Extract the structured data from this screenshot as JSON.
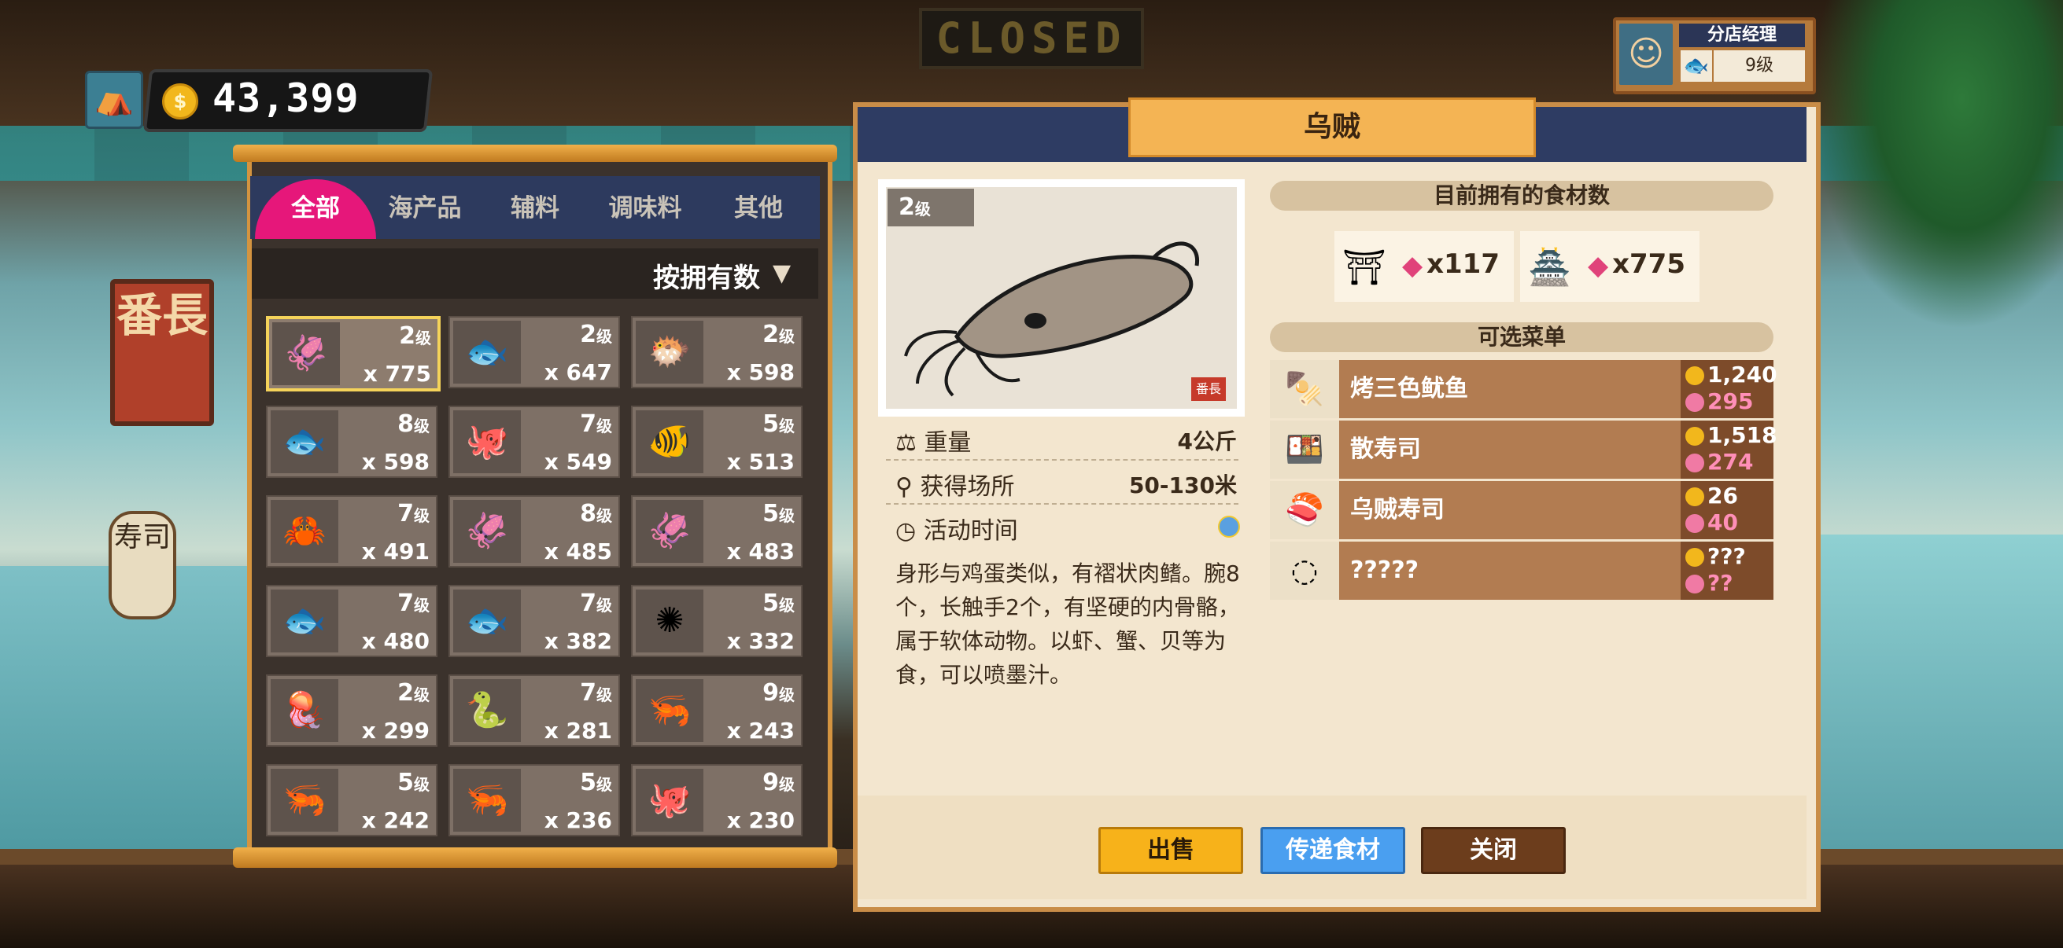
{
  "hud": {
    "home_icon": "hut-icon",
    "coins": "43,399",
    "coin_symbol": "$"
  },
  "scene": {
    "closed_sign": "CLOSED",
    "shop_sign": "番長",
    "lantern_text": "寿司"
  },
  "manager": {
    "title": "分店经理",
    "level": "9级"
  },
  "inventory": {
    "tabs": [
      "全部",
      "海产品",
      "辅料",
      "调味料",
      "其他"
    ],
    "sort_label": "按拥有数",
    "sort_arrow": "▼",
    "level_suffix": "级",
    "items": [
      {
        "name": "cuttlefish",
        "level": "2",
        "qty": "x 775",
        "icon": "🦑",
        "selected": true
      },
      {
        "name": "red-fish",
        "level": "2",
        "qty": "x 647",
        "icon": "🐟"
      },
      {
        "name": "yellow-fish",
        "level": "2",
        "qty": "x 598",
        "icon": "🐡"
      },
      {
        "name": "blue-fish",
        "level": "8",
        "qty": "x 598",
        "icon": "🐟"
      },
      {
        "name": "octopus",
        "level": "7",
        "qty": "x 549",
        "icon": "🐙"
      },
      {
        "name": "small-red-fish",
        "level": "5",
        "qty": "x 513",
        "icon": "🐠"
      },
      {
        "name": "blue-crab",
        "level": "7",
        "qty": "x 491",
        "icon": "🦀"
      },
      {
        "name": "purple-squid",
        "level": "8",
        "qty": "x 485",
        "icon": "🦑"
      },
      {
        "name": "grey-squid",
        "level": "5",
        "qty": "x 483",
        "icon": "🦑"
      },
      {
        "name": "silver-fish",
        "level": "7",
        "qty": "x 480",
        "icon": "🐟"
      },
      {
        "name": "tuna",
        "level": "7",
        "qty": "x 382",
        "icon": "🐟"
      },
      {
        "name": "sea-urchin",
        "level": "5",
        "qty": "x 332",
        "icon": "✺"
      },
      {
        "name": "jellyfish",
        "level": "2",
        "qty": "x 299",
        "icon": "🪼"
      },
      {
        "name": "eel",
        "level": "7",
        "qty": "x 281",
        "icon": "🐍"
      },
      {
        "name": "mantis-shrimp",
        "level": "9",
        "qty": "x 243",
        "icon": "🦐"
      },
      {
        "name": "prawn",
        "level": "5",
        "qty": "x 242",
        "icon": "🦐"
      },
      {
        "name": "shrimp",
        "level": "5",
        "qty": "x 236",
        "icon": "🦐"
      },
      {
        "name": "pale-octopus",
        "level": "9",
        "qty": "x 230",
        "icon": "🐙"
      }
    ]
  },
  "detail": {
    "title": "乌贼",
    "level_badge": "2",
    "level_suffix": "级",
    "stamp": "番長",
    "weight_label": "重量",
    "weight_value": "4公斤",
    "location_label": "获得场所",
    "location_value": "50-130米",
    "activity_label": "活动时间",
    "description": "身形与鸡蛋类似，有褶状肉鳍。腕8个，长触手2个，有坚硬的内骨骼，\n属于软体动物。以虾、蟹、贝等为食，可以喷墨汁。",
    "owned_header": "目前拥有的食材数",
    "owned": [
      {
        "shop_icon": "shop-icon",
        "qty": "x117"
      },
      {
        "shop_icon": "shop-icon",
        "qty": "x775"
      }
    ],
    "menu_header": "可选菜单",
    "menu": [
      {
        "name": "烤三色鱿鱼",
        "price": "1,240",
        "score": "295",
        "icon": "🍢"
      },
      {
        "name": "散寿司",
        "price": "1,518",
        "score": "274",
        "icon": "🍱"
      },
      {
        "name": "乌贼寿司",
        "price": "26",
        "score": "40",
        "icon": "🍣"
      },
      {
        "name": "?????",
        "price": "???",
        "score": "??",
        "icon": "◌"
      }
    ],
    "buttons": {
      "sell": "出售",
      "pass": "传递食材",
      "close": "关闭"
    }
  },
  "colors": {
    "tab_active": "#e6177a",
    "navy": "#2e3c63",
    "gold": "#f4b454",
    "sell": "#f7b21a",
    "pass": "#4a9ff0",
    "close": "#6c3d1c"
  }
}
